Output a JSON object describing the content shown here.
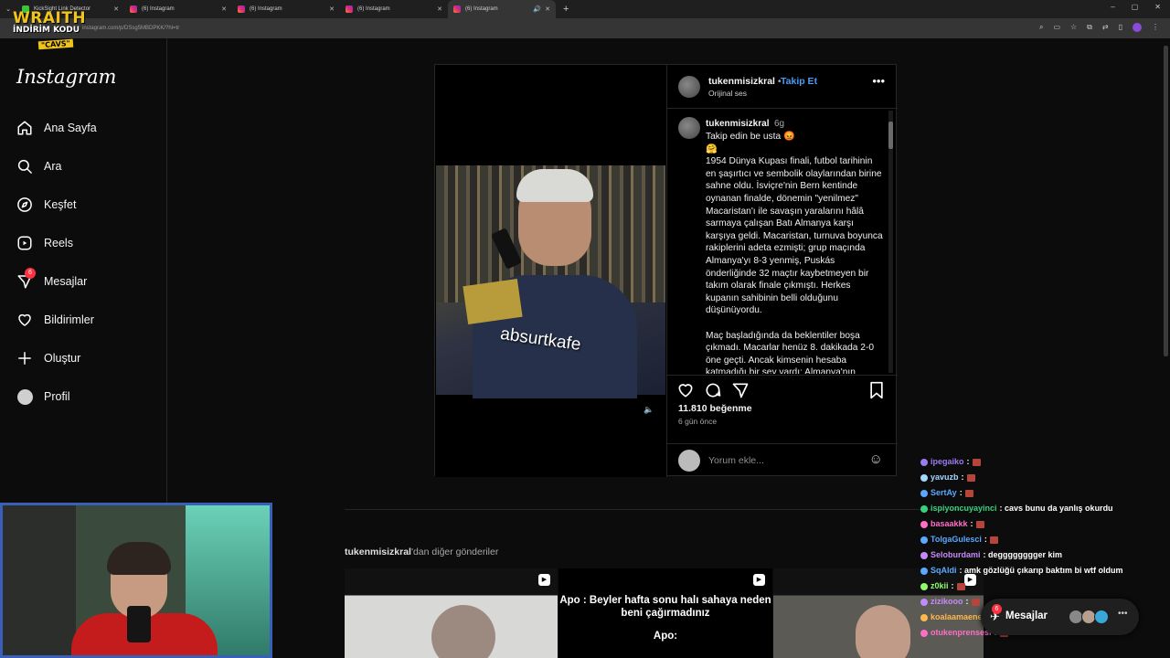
{
  "browser": {
    "tabs": [
      {
        "title": "KickSight Link Detector",
        "active": false
      },
      {
        "title": "(6) Instagram",
        "active": false
      },
      {
        "title": "(6) Instagram",
        "active": false
      },
      {
        "title": "(6) Instagram",
        "active": false
      },
      {
        "title": "(6) Instagram",
        "active": true
      }
    ],
    "url": "instagram.com/p/DSsg5MBDPKK/?hl=tr"
  },
  "overlay": {
    "line1": "WRAITH",
    "line2": "İNDİRİM KODU",
    "line3": "\"CAVS\""
  },
  "sidebar": {
    "logo": "Instagram",
    "items": [
      {
        "label": "Ana Sayfa",
        "icon": "home-icon"
      },
      {
        "label": "Ara",
        "icon": "search-icon"
      },
      {
        "label": "Keşfet",
        "icon": "compass-icon"
      },
      {
        "label": "Reels",
        "icon": "reels-icon"
      },
      {
        "label": "Mesajlar",
        "icon": "messenger-icon",
        "badge": "6"
      },
      {
        "label": "Bildirimler",
        "icon": "heart-icon"
      },
      {
        "label": "Oluştur",
        "icon": "plus-icon"
      },
      {
        "label": "Profil",
        "icon": "profile-avatar"
      }
    ]
  },
  "post": {
    "username": "tukenmisizkral",
    "separator": "•",
    "follow": "Takip Et",
    "audio": "Orijinal ses",
    "video_watermark": "absurtkafe",
    "caption_user": "tukenmisizkral",
    "caption_time": "6g",
    "caption_line1": "Takip edin be usta 😡",
    "caption_line2": "🤗",
    "caption_p1": "1954 Dünya Kupası finali, futbol tarihinin en şaşırtıcı ve sembolik olaylarından birine sahne oldu. İsviçre'nin Bern kentinde oynanan finalde, dönemin \"yenilmez\" Macaristan'ı ile savaşın yaralarını hâlâ sarmaya çalışan Batı Almanya karşı karşıya geldi. Macaristan, turnuva boyunca rakiplerini adeta ezmişti; grup maçında Almanya'yı 8-3 yenmiş, Puskás önderliğinde 32 maçtır kaybetmeyen bir takım olarak finale çıkmıştı. Herkes kupanın sahibinin belli olduğunu düşünüyordu.",
    "caption_p2": "Maç başladığında da beklentiler boşa çıkmadı. Macarlar henüz 8. dakikada 2-0 öne geçti. Ancak kimsenin hesaba katmadığı bir şey vardı: Almanya'nın",
    "likes": "11.810 beğenme",
    "ago": "6 gün önce",
    "comment_placeholder": "Yorum ekle..."
  },
  "more_posts": {
    "user": "tukenmisizkral",
    "suffix": "'dan diğer gönderiler",
    "thumb2_caption": "Apo : Beyler hafta sonu halı sahaya neden beni çağırmadınız",
    "thumb2_apo": "Apo:"
  },
  "chat": [
    {
      "user": "ipegaiko",
      "msg": ":",
      "color": "#9b7cf0"
    },
    {
      "user": "yavuzb",
      "msg": ":",
      "color": "#a3d9ff"
    },
    {
      "user": "SertAy",
      "msg": ":",
      "color": "#5aa9ff"
    },
    {
      "user": "ispiyoncuyayinci",
      "msg": ": cavs bunu da yanlış okurdu",
      "color": "#37d17a"
    },
    {
      "user": "basaakkk",
      "msg": ":",
      "color": "#ff6ec7"
    },
    {
      "user": "TolgaGulesci",
      "msg": ":",
      "color": "#5aa9ff"
    },
    {
      "user": "Seloburdami",
      "msg": ": degggggggger kim",
      "color": "#c58af9"
    },
    {
      "user": "SqAldi",
      "msg": ": amk gözlüğü çıkarıp baktım bi wtf oldum",
      "color": "#5aa9ff"
    },
    {
      "user": "z0kii",
      "msg": ":",
      "color": "#8cff6e"
    },
    {
      "user": "zizikooo",
      "msg": ":",
      "color": "#c58af9"
    },
    {
      "user": "koalaamaenerjik",
      "msg": ":",
      "color": "#ffb84d"
    },
    {
      "user": "otukenprensesi",
      "msg": ":",
      "color": "#ff6ec7"
    }
  ],
  "dm_bar": {
    "label": "Mesajlar",
    "badge": "6"
  }
}
